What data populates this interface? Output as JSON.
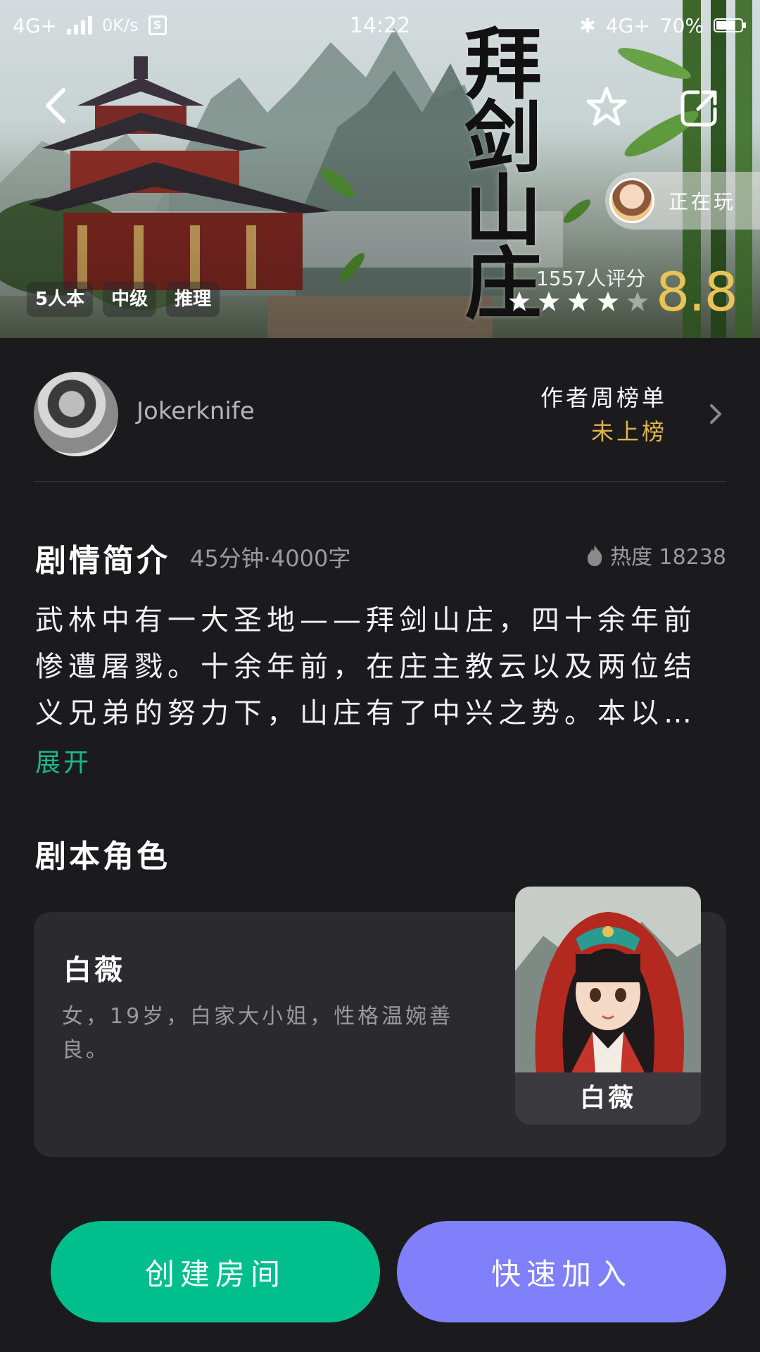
{
  "status_bar": {
    "network": "4G+",
    "speed": "0K/s",
    "sim_badge": "S",
    "time": "14:22",
    "network_right": "4G+",
    "battery": "70%"
  },
  "hero": {
    "title_chars": [
      "拜",
      "剑",
      "山",
      "庄"
    ],
    "playing_label": "正在玩",
    "tags": [
      "5人本",
      "中级",
      "推理"
    ],
    "rating_count": "1557人评分",
    "rating_score": "8.8",
    "stars": 4.5,
    "colors": {
      "score": "#e9c355"
    }
  },
  "author": {
    "name": "Jokerknife",
    "rank_title": "作者周榜单",
    "rank_status": "未上榜"
  },
  "synopsis": {
    "title": "剧情简介",
    "meta": "45分钟·4000字",
    "heat": "热度 18238",
    "text": "武林中有一大圣地——拜剑山庄，四十余年前惨遭屠戮。十余年前，在庄主教云以及两位结义兄弟的努力下，山庄有了中兴之势。本以…",
    "expand": "展开"
  },
  "roles": {
    "title": "剧本角色",
    "items": [
      {
        "name": "白薇",
        "desc": "女，19岁，白家大小姐，性格温婉善良。",
        "card_name": "白薇"
      }
    ]
  },
  "actions": {
    "create": "创建房间",
    "join": "快速加入",
    "colors": {
      "create": "#00bf8c",
      "join": "#8180fb"
    }
  }
}
